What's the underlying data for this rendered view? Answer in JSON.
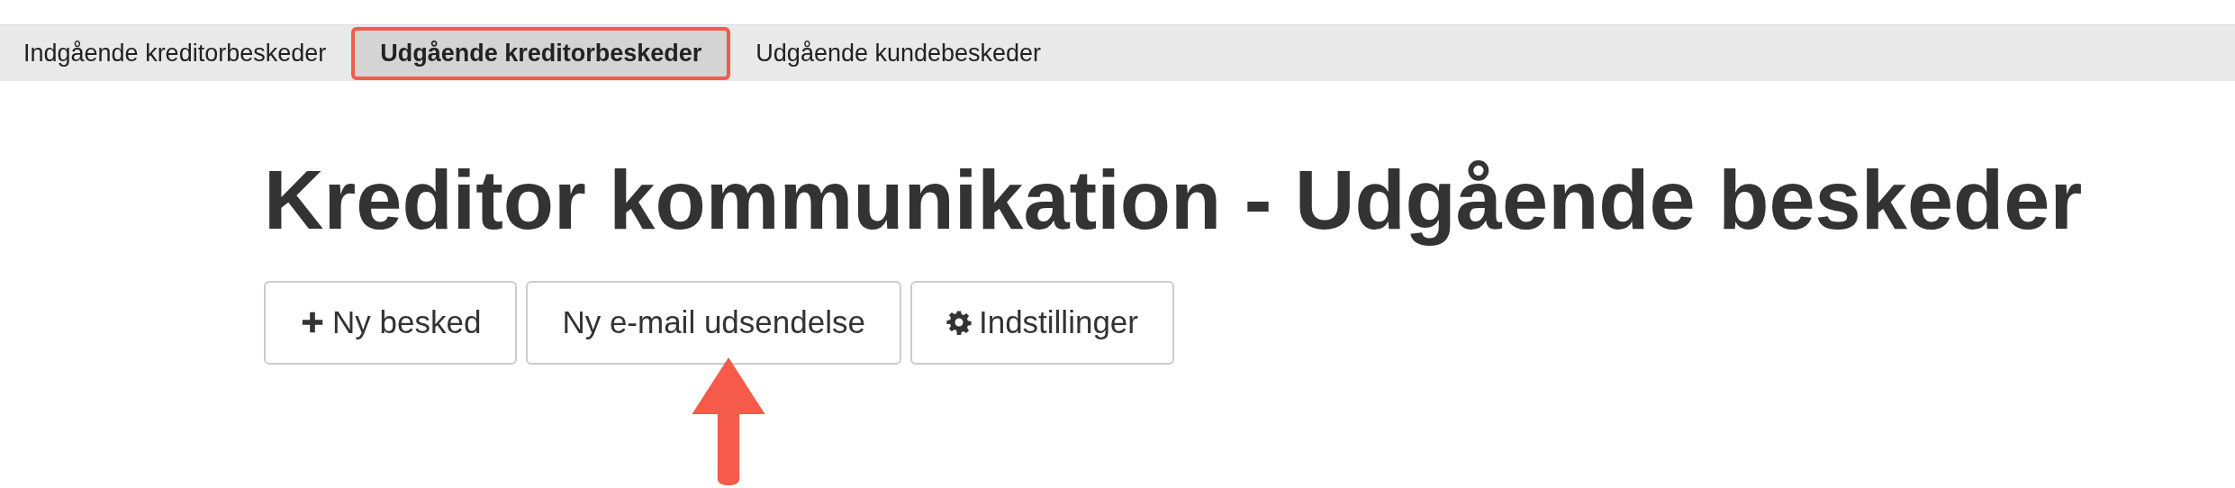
{
  "tabs": [
    {
      "label": "Indgående kreditorbeskeder",
      "selected": false
    },
    {
      "label": "Udgående kreditorbeskeder",
      "selected": true
    },
    {
      "label": "Udgående kundebeskeder",
      "selected": false
    }
  ],
  "heading": "Kreditor kommunikation - Udgående beskeder",
  "buttons": [
    {
      "label": "Ny besked",
      "kind": "add"
    },
    {
      "label": "Ny e-mail udsendelse",
      "kind": "plain"
    },
    {
      "label": "Indstillinger",
      "kind": "settings"
    }
  ]
}
